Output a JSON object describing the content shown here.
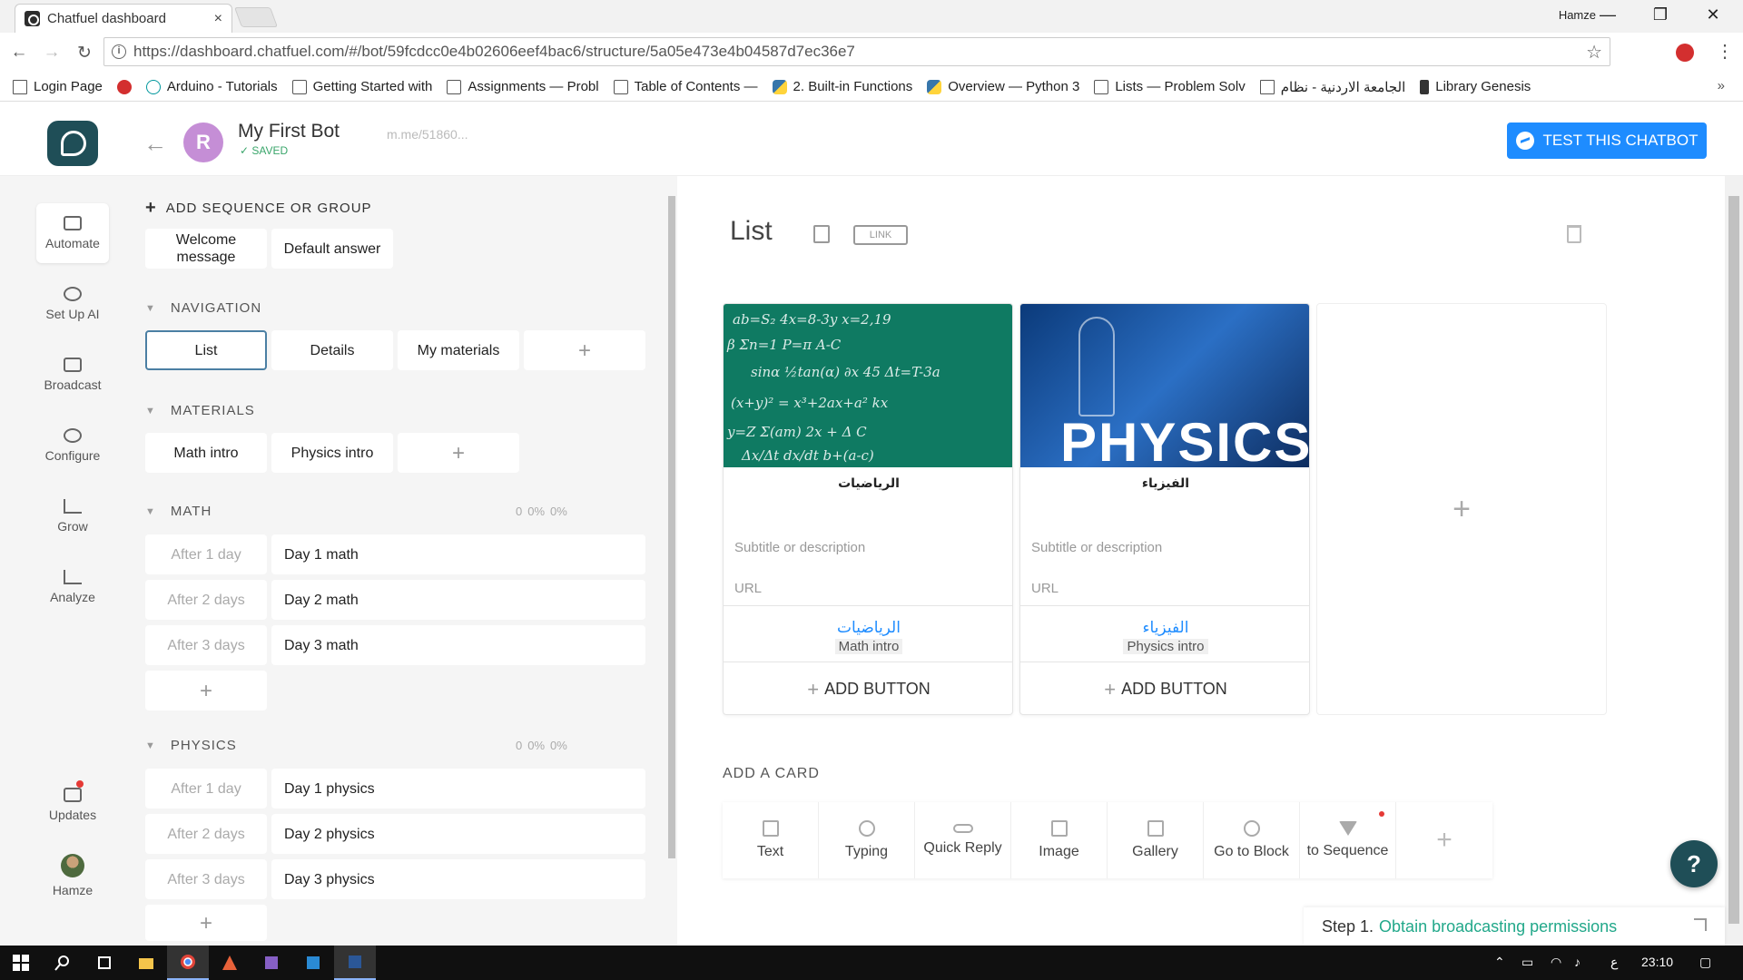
{
  "browser": {
    "tab_title": "Chatfuel dashboard",
    "tab_close": "×",
    "window_user": "Hamze",
    "minimize": "—",
    "restore": "❐",
    "close": "✕",
    "back": "←",
    "forward": "→",
    "reload": "↻",
    "url": "https://dashboard.chatfuel.com/#/bot/59fcdcc0e4b02606eef4bac6/structure/5a05e473e4b04587d7ec36e7",
    "star": "☆",
    "menu": "⋮",
    "bookmarks": [
      {
        "label": "Login Page",
        "icon": "doc-icon"
      },
      {
        "label": "",
        "icon": "record-icon"
      },
      {
        "label": "Arduino - Tutorials",
        "icon": "arduino-icon"
      },
      {
        "label": "Getting Started with",
        "icon": "page-icon"
      },
      {
        "label": "Assignments — Probl",
        "icon": "page-icon"
      },
      {
        "label": "Table of Contents —",
        "icon": "page-icon"
      },
      {
        "label": "2. Built-in Functions",
        "icon": "python-icon"
      },
      {
        "label": "Overview — Python 3",
        "icon": "python-icon"
      },
      {
        "label": "Lists — Problem Solv",
        "icon": "page-icon"
      },
      {
        "label": "الجامعة الاردنية - نظام",
        "icon": "doc-icon"
      },
      {
        "label": "Library Genesis",
        "icon": "library-icon"
      }
    ],
    "bookmarks_more": "»"
  },
  "header": {
    "back": "←",
    "bot_avatar_letter": "R",
    "bot_name": "My First Bot",
    "saved": "✓ SAVED",
    "bot_link": "m.me/51860...",
    "test_button": "TEST THIS CHATBOT"
  },
  "leftnav": {
    "items": [
      {
        "label": "Automate",
        "icon": "automate-icon"
      },
      {
        "label": "Set Up AI",
        "icon": "ai-icon"
      },
      {
        "label": "Broadcast",
        "icon": "megaphone-icon"
      },
      {
        "label": "Configure",
        "icon": "gear-icon"
      },
      {
        "label": "Grow",
        "icon": "grow-icon"
      },
      {
        "label": "Analyze",
        "icon": "chart-icon"
      }
    ],
    "updates": "Updates",
    "user": "Hamze"
  },
  "structure": {
    "add_sequence": "ADD SEQUENCE OR GROUP",
    "add_plus": "+",
    "top_blocks": [
      "Welcome message",
      "Default answer"
    ],
    "navigation": {
      "title": "NAVIGATION",
      "blocks": [
        "List",
        "Details",
        "My materials"
      ]
    },
    "materials": {
      "title": "MATERIALS",
      "blocks": [
        "Math intro",
        "Physics intro"
      ]
    },
    "math": {
      "title": "MATH",
      "stats": [
        "0",
        "0%",
        "0%"
      ],
      "rows": [
        {
          "delay": "After 1 day",
          "block": "Day 1 math"
        },
        {
          "delay": "After 2 days",
          "block": "Day 2 math"
        },
        {
          "delay": "After 3 days",
          "block": "Day 3 math"
        }
      ]
    },
    "physics": {
      "title": "PHYSICS",
      "stats": [
        "0",
        "0%",
        "0%"
      ],
      "rows": [
        {
          "delay": "After 1 day",
          "block": "Day 1 physics"
        },
        {
          "delay": "After 2 days",
          "block": "Day 2 physics"
        },
        {
          "delay": "After 3 days",
          "block": "Day 3 physics"
        }
      ]
    },
    "caret": "▼",
    "add": "+"
  },
  "editor": {
    "block_title": "List",
    "link_label": "LINK",
    "cards": [
      {
        "title": "الرياضيات",
        "subtitle_placeholder": "Subtitle or description",
        "url_placeholder": "URL",
        "button_label": "الرياضيات",
        "button_target": "Math intro",
        "add_button": "ADD BUTTON"
      },
      {
        "title": "الفيزياء",
        "subtitle_placeholder": "Subtitle or description",
        "url_placeholder": "URL",
        "button_label": "الفيزياء",
        "button_target": "Physics intro",
        "add_button": "ADD BUTTON",
        "image_text": "PHYSICS"
      }
    ],
    "add_card_plus": "+",
    "add_a_card": "ADD A CARD",
    "plugins": [
      {
        "label": "Text",
        "icon": "text-icon"
      },
      {
        "label": "Typing",
        "icon": "typing-icon"
      },
      {
        "label": "Quick Reply",
        "icon": "quick-reply-icon"
      },
      {
        "label": "Image",
        "icon": "image-icon"
      },
      {
        "label": "Gallery",
        "icon": "gallery-icon"
      },
      {
        "label": "Go to Block",
        "icon": "go-to-block-icon"
      },
      {
        "label": "to Sequence",
        "icon": "funnel-icon"
      }
    ],
    "help": "?",
    "onboarding": {
      "step": "Step 1.",
      "link": "Obtain broadcasting permissions"
    }
  },
  "taskbar": {
    "time": "23:10",
    "lang": "ع"
  }
}
